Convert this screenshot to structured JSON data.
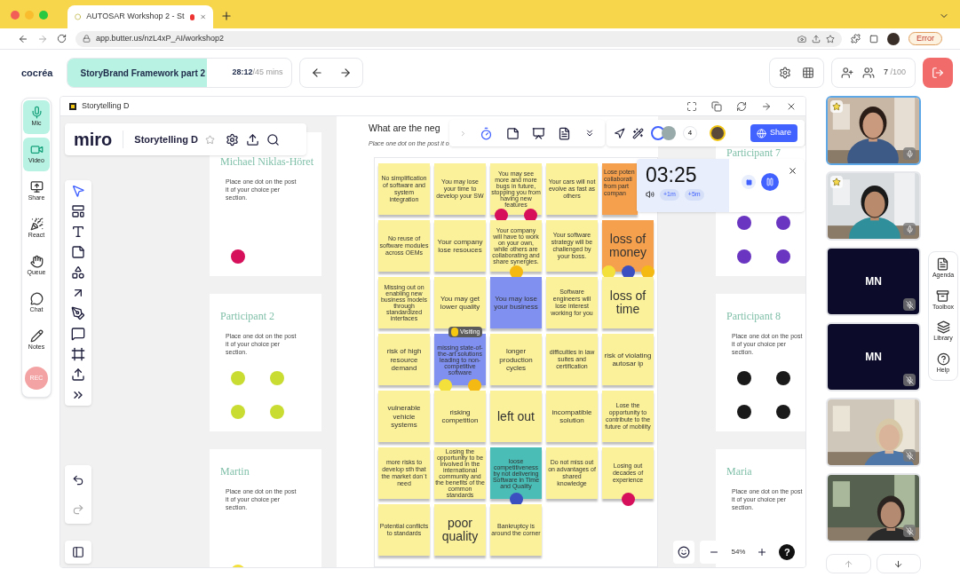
{
  "browser": {
    "tab_title": "AUTOSAR Workshop 2 - St",
    "address": "app.butter.us/nzL4xP_AI/workshop2",
    "error_badge": "Error"
  },
  "header": {
    "logo": "cocréa",
    "session": {
      "title": "StoryBrand Framework part 2",
      "elapsed": "28:12",
      "total": "/45 mins",
      "level": 0.62
    },
    "participants": "7",
    "capacity": "/100"
  },
  "rail": [
    {
      "label": "Mic",
      "kind": "mic",
      "on": true
    },
    {
      "label": "Video",
      "kind": "video",
      "on": true
    },
    {
      "label": "Share",
      "kind": "share",
      "on": false
    },
    {
      "label": "React",
      "kind": "react",
      "on": false
    },
    {
      "label": "Queue",
      "kind": "queue",
      "on": false
    },
    {
      "label": "Chat",
      "kind": "chat",
      "on": false
    },
    {
      "label": "Notes",
      "kind": "notes",
      "on": false
    },
    {
      "label": "REC",
      "kind": "rec",
      "on": false
    }
  ],
  "miro": {
    "frame_title": "Storytelling D",
    "logo": "miro",
    "board_name": "Storytelling D",
    "tools": [
      {
        "selected": true
      },
      {
        "selected": false
      },
      {
        "selected": false
      },
      {
        "selected": false
      },
      {
        "selected": false
      },
      {
        "selected": false
      },
      {
        "selected": false
      },
      {
        "selected": false
      },
      {
        "selected": false
      },
      {
        "selected": false
      },
      {
        "selected": false
      }
    ],
    "collaborators_count": "4",
    "share": "Share",
    "zoom": "54%",
    "help": "?",
    "visiting": "Visiting"
  },
  "timer": {
    "time": "03:25",
    "add": [
      "+1m",
      "+5m"
    ]
  },
  "board": {
    "question": "What are the neg",
    "hint": "Place one dot on the post it o",
    "notes": [
      {
        "text": "No simplification of software and system integration",
        "color": "#fbf19a"
      },
      {
        "text": "You may lose your time to develop your SW",
        "color": "#fbf19a"
      },
      {
        "text": "You may see more and more bugs in future, stopping you from having new features",
        "color": "#fbf19a",
        "dots": [
          {
            "color": "#d6105a"
          },
          {
            "color": "#d6105a"
          }
        ]
      },
      {
        "text": "Your cars will not evolve as fast as others",
        "color": "#fbf19a"
      },
      {
        "text": "Lose poten collaborati from part compan",
        "color": "#f5a04c",
        "partly_hidden": true
      },
      {
        "text": "No reuse of software modules across OEMs",
        "color": "#fbf19a"
      },
      {
        "text": "Your company lose resouces",
        "color": "#fbf19a"
      },
      {
        "text": "Your company will have to work on your own, while others are collaborating and share synergies.",
        "color": "#fbf19a",
        "dots": [
          {
            "color": "#f5b914"
          }
        ]
      },
      {
        "text": "Your software strategy will be challenged by your boss.",
        "color": "#fbf19a"
      },
      {
        "text": "loss of money",
        "color": "#f5a04c",
        "dots": [
          {
            "color": "#f3e03a"
          },
          {
            "color": "#3c4fc0"
          },
          {
            "color": "#f5b914"
          }
        ]
      },
      {
        "text": "Missing out on enabling new business models through standardized interfaces",
        "color": "#fbf19a"
      },
      {
        "text": "You may get lower quality",
        "color": "#fbf19a",
        "visiting": true
      },
      {
        "text": "You may lose your business",
        "color": "#7f90f0"
      },
      {
        "text": "Software engineers will lose interest working for you",
        "color": "#fbf19a"
      },
      {
        "text": "loss of time",
        "color": "#fbf19a"
      },
      {
        "text": "risk of high resource demand",
        "color": "#fbf19a"
      },
      {
        "text": "missing state-of-the-art solutions leading to non-competitive software",
        "color": "#7f90f0",
        "dots": [
          {
            "color": "#f3e03a"
          },
          {
            "color": "#f5b914"
          }
        ]
      },
      {
        "text": "longer production cycles",
        "color": "#fbf19a"
      },
      {
        "text": "difficulties in law suites and certification",
        "color": "#fbf19a"
      },
      {
        "text": "risk of violating autosar ip",
        "color": "#fbf19a"
      },
      {
        "text": "vulnerable vehicle systems",
        "color": "#fbf19a"
      },
      {
        "text": "risking competition",
        "color": "#fbf19a"
      },
      {
        "text": "left out",
        "color": "#fbf19a"
      },
      {
        "text": "incompatible solution",
        "color": "#fbf19a"
      },
      {
        "text": "Lose the opportunity to contribute to the future of mobility",
        "color": "#fbf19a"
      },
      {
        "text": "more risks to develop sth that the market don´t need",
        "color": "#fbf19a"
      },
      {
        "text": "Losing the opportunity to be involved in the international community and the benefits of the common standards",
        "color": "#fbf19a"
      },
      {
        "text": "loose competitiveness by not delivering Software in Time and Quality",
        "color": "#49bdb6",
        "dots": [
          {
            "color": "#3c4fc0"
          }
        ]
      },
      {
        "text": "Do not miss out on advantages of shared knowledge",
        "color": "#fbf19a"
      },
      {
        "text": "Losing out decades of experience",
        "color": "#fbf19a",
        "dots": [
          {
            "color": "#d6105a"
          }
        ]
      },
      {
        "text": "Potential conflicts to standards",
        "color": "#fbf19a"
      },
      {
        "text": "poor quality",
        "color": "#fbf19a"
      },
      {
        "text": "Bankruptcy is around the corner",
        "color": "#fbf19a"
      }
    ]
  },
  "left_cards": [
    {
      "name": "Michael Niklas-Höret",
      "text": "Place one dot on the post it of your choice per section.",
      "dots": [
        {
          "color": "#d6105a"
        }
      ]
    },
    {
      "name": "Participant 2",
      "text": "Place one dot on the post it of your choice per section.",
      "dots": [
        {
          "color": "#c8dc32"
        },
        {
          "color": "#c8dc32"
        },
        {
          "color": "#c8dc32"
        },
        {
          "color": "#c8dc32"
        }
      ]
    },
    {
      "name": "Martin",
      "text": "Place one dot on the post it of your choice per section.",
      "dots": [
        {
          "color": "#f3e03a"
        }
      ]
    }
  ],
  "right_cards": [
    {
      "name": "Participant 7",
      "dots": [
        {
          "color": "#6a35c0"
        },
        {
          "color": "#6a35c0"
        },
        {
          "color": "#6a35c0"
        },
        {
          "color": "#6a35c0"
        }
      ]
    },
    {
      "name": "Participant 8",
      "text": "Place one dot on the post it of your choice per section.",
      "dots": [
        {
          "color": "#1a1a1a"
        },
        {
          "color": "#1a1a1a"
        },
        {
          "color": "#1a1a1a"
        },
        {
          "color": "#1a1a1a"
        }
      ]
    },
    {
      "name": "Maria",
      "text": "Place one dot on the post it of your choice per section."
    }
  ],
  "videos": [
    {
      "kind": "picture",
      "starred": true,
      "selected": true,
      "muted": false
    },
    {
      "kind": "picture",
      "starred": true,
      "selected": false,
      "muted": false
    },
    {
      "kind": "initials",
      "initials": "MN",
      "starred": false,
      "selected": false,
      "muted": true
    },
    {
      "kind": "initials",
      "initials": "MN",
      "starred": false,
      "selected": false,
      "muted": true
    },
    {
      "kind": "picture",
      "starred": false,
      "selected": false,
      "muted": true
    },
    {
      "kind": "picture",
      "starred": false,
      "selected": false,
      "muted": true
    }
  ],
  "side_panel": [
    {
      "label": "Agenda",
      "kind": "agenda"
    },
    {
      "label": "Toolbox",
      "kind": "toolbox"
    },
    {
      "label": "Library",
      "kind": "library"
    },
    {
      "label": "Help",
      "kind": "help"
    }
  ]
}
